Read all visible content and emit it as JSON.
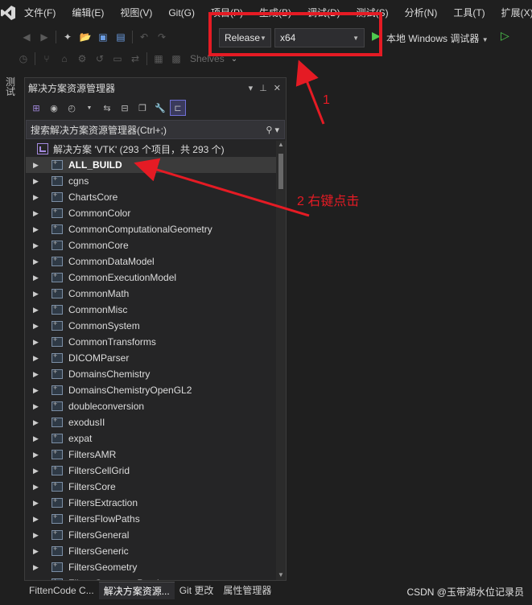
{
  "menu": [
    "文件(F)",
    "编辑(E)",
    "视图(V)",
    "Git(G)",
    "项目(P)",
    "生成(B)",
    "调试(D)",
    "测试(S)",
    "分析(N)",
    "工具(T)",
    "扩展(X)"
  ],
  "toolbar": {
    "config": "Release",
    "platform": "x64",
    "run_label": "本地 Windows 调试器",
    "shelves": "Shelves"
  },
  "side_strip_label": "测试",
  "panel": {
    "title": "解决方案资源管理器",
    "search_placeholder": "搜索解决方案资源管理器(Ctrl+;)",
    "solution_label": "解决方案 'VTK' (293 个项目，共 293 个)",
    "projects": [
      "ALL_BUILD",
      "cgns",
      "ChartsCore",
      "CommonColor",
      "CommonComputationalGeometry",
      "CommonCore",
      "CommonDataModel",
      "CommonExecutionModel",
      "CommonMath",
      "CommonMisc",
      "CommonSystem",
      "CommonTransforms",
      "DICOMParser",
      "DomainsChemistry",
      "DomainsChemistryOpenGL2",
      "doubleconversion",
      "exodusII",
      "expat",
      "FiltersAMR",
      "FiltersCellGrid",
      "FiltersCore",
      "FiltersExtraction",
      "FiltersFlowPaths",
      "FiltersGeneral",
      "FiltersGeneric",
      "FiltersGeometry",
      "FiltersGeometryPreview"
    ],
    "selected_index": 0
  },
  "annotations": {
    "step1": "1",
    "step2": "2 右键点击"
  },
  "bottom_tabs": [
    "FittenCode C...",
    "解决方案资源...",
    "Git 更改",
    "属性管理器"
  ],
  "active_bottom_tab": 1,
  "watermark": "CSDN @玉带湖水位记录员",
  "colors": {
    "annotation_red": "#e51b24",
    "run_green": "#4ec94e",
    "accent_purple": "#a48adf"
  }
}
